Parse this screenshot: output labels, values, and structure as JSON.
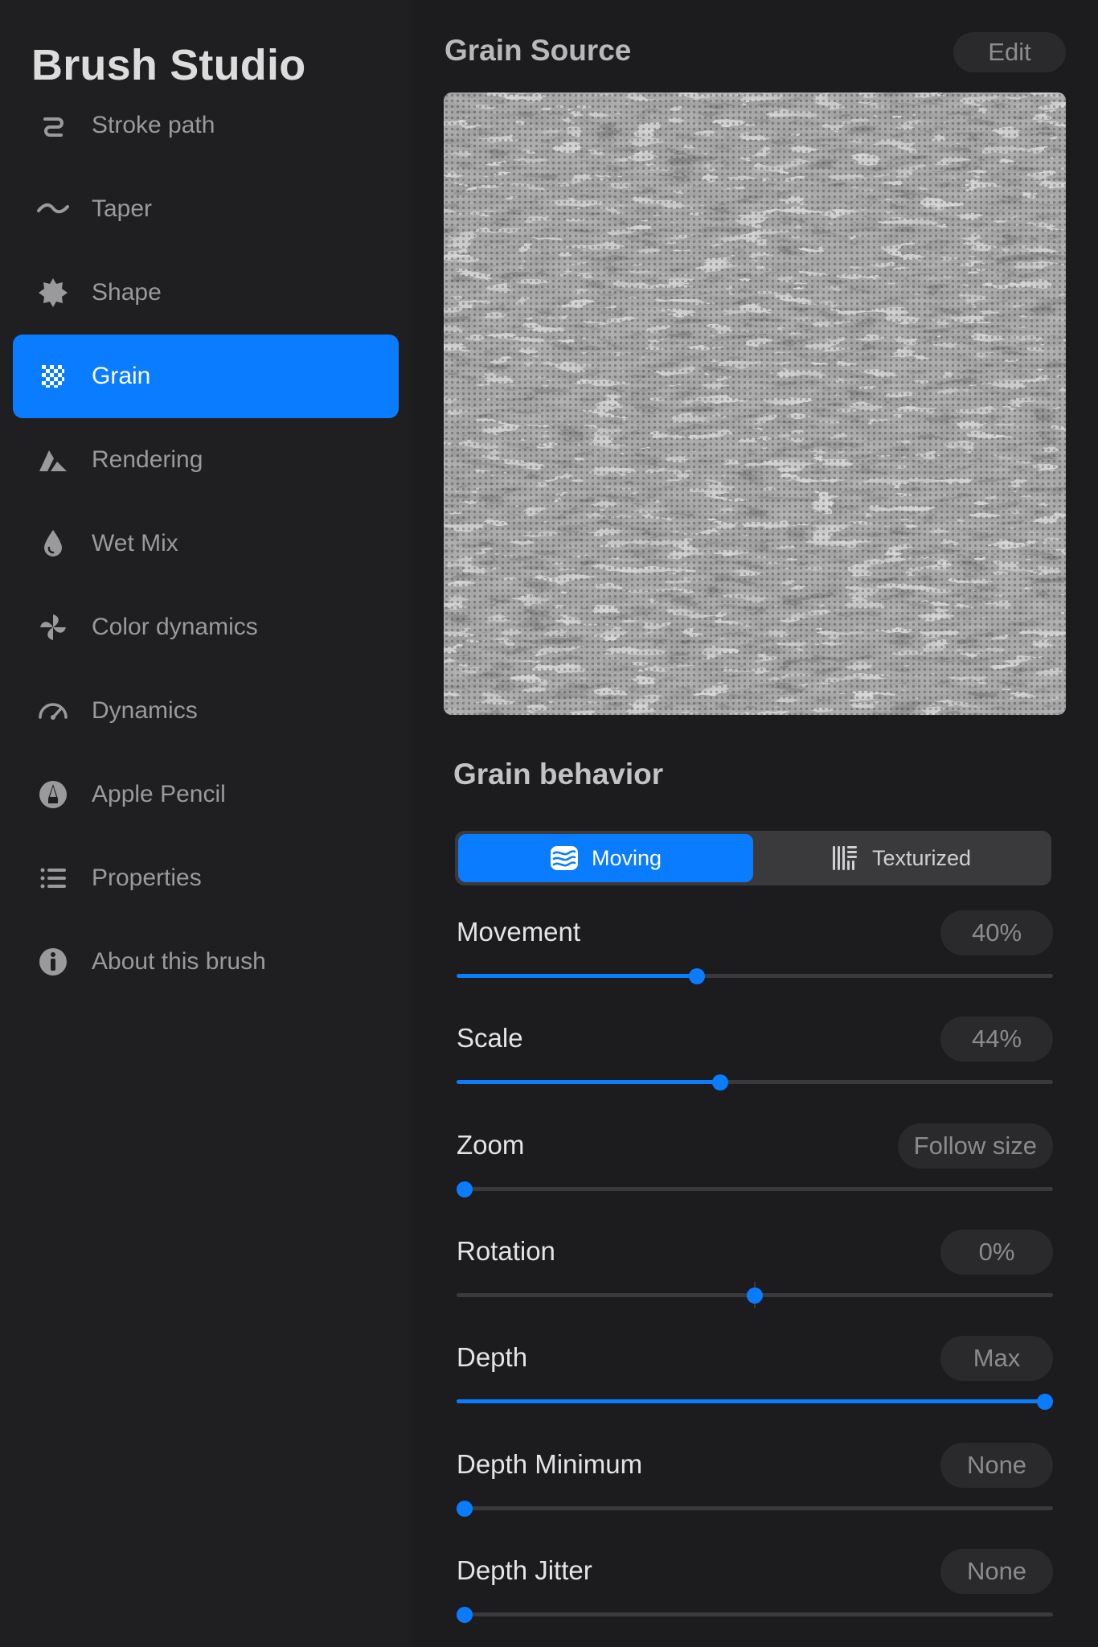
{
  "sidebar": {
    "title": "Brush Studio",
    "items": [
      {
        "label": "Stroke path",
        "icon": "stroke-path-icon"
      },
      {
        "label": "Taper",
        "icon": "taper-icon"
      },
      {
        "label": "Shape",
        "icon": "shape-icon"
      },
      {
        "label": "Grain",
        "icon": "grain-icon",
        "active": true
      },
      {
        "label": "Rendering",
        "icon": "rendering-icon"
      },
      {
        "label": "Wet Mix",
        "icon": "droplet-icon"
      },
      {
        "label": "Color dynamics",
        "icon": "pinwheel-icon"
      },
      {
        "label": "Dynamics",
        "icon": "speedometer-icon"
      },
      {
        "label": "Apple Pencil",
        "icon": "pencil-tip-icon"
      },
      {
        "label": "Properties",
        "icon": "list-icon"
      },
      {
        "label": "About this brush",
        "icon": "info-icon"
      }
    ]
  },
  "main": {
    "source_title": "Grain Source",
    "edit_label": "Edit",
    "behavior_title": "Grain behavior",
    "segments": [
      {
        "label": "Moving",
        "icon": "waves-icon",
        "selected": true
      },
      {
        "label": "Texturized",
        "icon": "texture-icon",
        "selected": false
      }
    ],
    "settings": [
      {
        "label": "Movement",
        "value": "40%",
        "level": 0.4
      },
      {
        "label": "Scale",
        "value": "44%",
        "level": 0.44
      },
      {
        "label": "Zoom",
        "value": "Follow size",
        "level": 0.0
      },
      {
        "label": "Rotation",
        "value": "0%",
        "level": 0.5,
        "centered": true
      },
      {
        "label": "Depth",
        "value": "Max",
        "level": 1.0
      },
      {
        "label": "Depth Minimum",
        "value": "None",
        "level": 0.0
      },
      {
        "label": "Depth Jitter",
        "value": "None",
        "level": 0.0
      }
    ]
  },
  "colors": {
    "accent": "#0a7cff",
    "background": "#1c1c1e",
    "sidebar_background": "#1f1f21"
  }
}
